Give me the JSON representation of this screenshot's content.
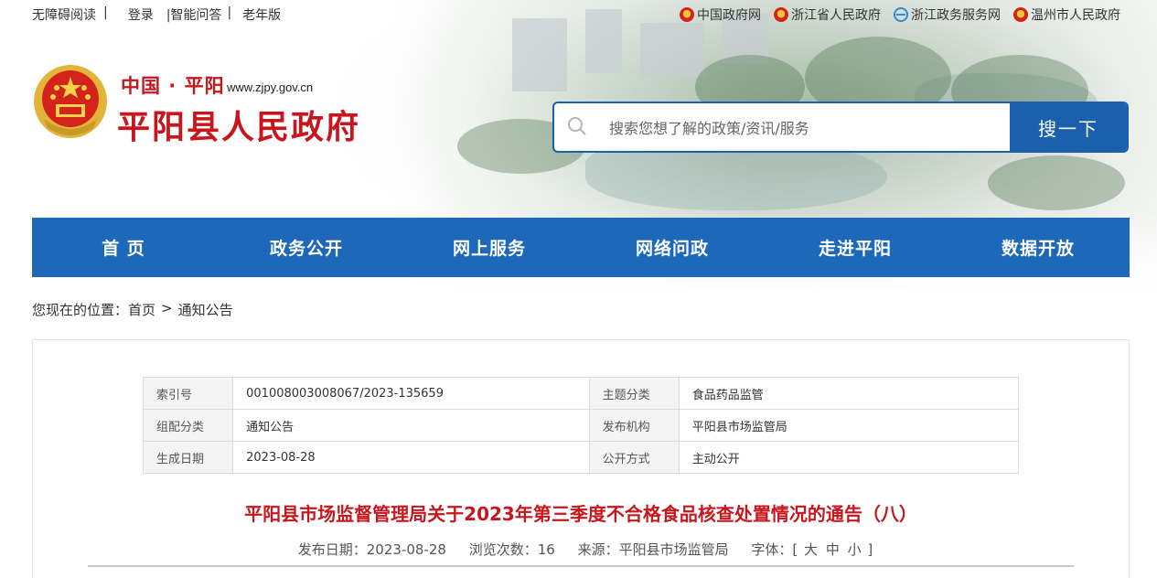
{
  "topbar": {
    "left": [
      "无障碍阅读",
      "|",
      "登录",
      "|智能问答",
      "|",
      "老年版"
    ],
    "links": [
      {
        "label": "中国政府网",
        "icon": "national-emblem-icon"
      },
      {
        "label": "浙江省人民政府",
        "icon": "national-emblem-icon"
      },
      {
        "label": "浙江政务服务网",
        "icon": "globe-icon"
      },
      {
        "label": "温州市人民政府",
        "icon": "national-emblem-icon"
      }
    ]
  },
  "brand": {
    "sub": "中国 · 平阳",
    "url": "www.zjpy.gov.cn",
    "name": "平阳县人民政府"
  },
  "search": {
    "placeholder": "搜索您想了解的政策/资讯/服务",
    "button": "搜一下"
  },
  "nav": [
    "首 页",
    "政务公开",
    "网上服务",
    "网络问政",
    "走进平阳",
    "数据开放"
  ],
  "breadcrumb": {
    "prefix": "您现在的位置：",
    "home": "首页",
    "sep": ">",
    "current": "通知公告"
  },
  "meta": {
    "rows": [
      {
        "k1": "索引号",
        "v1": "001008003008067/2023-135659",
        "k2": "主题分类",
        "v2": "食品药品监管"
      },
      {
        "k1": "组配分类",
        "v1": "通知公告",
        "k2": "发布机构",
        "v2": "平阳县市场监管局"
      },
      {
        "k1": "生成日期",
        "v1": "2023-08-28",
        "k2": "公开方式",
        "v2": "主动公开"
      }
    ]
  },
  "article": {
    "title": "平阳县市场监督管理局关于2023年第三季度不合格食品核查处置情况的通告（八）",
    "date": "发布日期：2023-08-28",
    "views": "浏览次数：16",
    "source": "来源：平阳县市场监管局",
    "font_label": "字体：[",
    "font_large": "大",
    "font_medium": "中",
    "font_small": "小",
    "font_close": "]"
  },
  "colors": {
    "brand_red": "#c8161d",
    "nav_blue": "#1d68b8",
    "search_blue": "#1b5fae"
  }
}
